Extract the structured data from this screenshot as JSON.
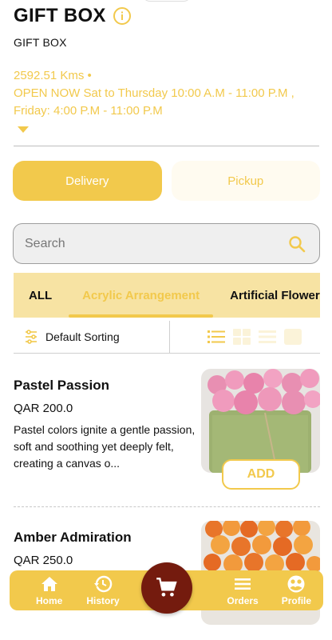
{
  "store": {
    "title": "GIFT BOX",
    "subtitle": "GIFT BOX",
    "distance": "2592.51 Kms •",
    "hours": "OPEN NOW  Sat to Thursday 10:00 A.M - 11:00 P.M , Friday: 4:00 P.M - 11:00 P.M"
  },
  "mode_tabs": [
    {
      "label": "Delivery",
      "active": true
    },
    {
      "label": "Pickup",
      "active": false
    }
  ],
  "search": {
    "placeholder": "Search"
  },
  "categories": [
    {
      "label": "ALL",
      "active": false
    },
    {
      "label": "Acrylic Arrangement",
      "active": true
    },
    {
      "label": "Artificial Flowers",
      "active": false
    }
  ],
  "sort": {
    "label": "Default Sorting"
  },
  "products": [
    {
      "name": "Pastel Passion",
      "price": "QAR 200.0",
      "description": "Pastel colors ignite a gentle passion, soft and soothing yet deeply felt, creating a canvas o...",
      "add_label": "ADD"
    },
    {
      "name": "Amber Admiration",
      "price": "QAR 250.0"
    }
  ],
  "bottom_nav": {
    "home": "Home",
    "history": "History",
    "orders": "Orders",
    "profile": "Profile"
  },
  "colors": {
    "accent": "#f2c94c",
    "cart": "#741b0e"
  }
}
